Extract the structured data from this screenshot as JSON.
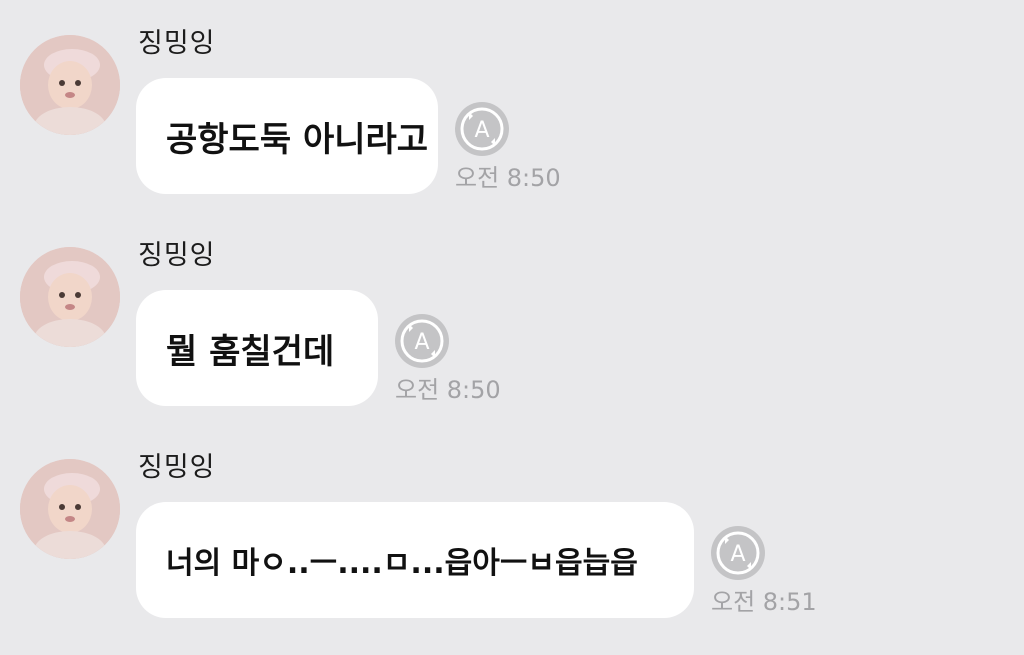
{
  "messages": [
    {
      "sender": "징밍잉",
      "text": "공항도둑 아니라고",
      "time": "오전 8:50",
      "avatar_icon": "baby-photo-avatar",
      "action_icon": "auto-translate-icon"
    },
    {
      "sender": "징밍잉",
      "text": "뭘 훔칠건데",
      "time": "오전 8:50",
      "avatar_icon": "baby-photo-avatar",
      "action_icon": "auto-translate-icon"
    },
    {
      "sender": "징밍잉",
      "text": "너의 마ㅇ..ㅡ....ㅁ...읍아ㅡㅂ읍늡읍",
      "time": "오전 8:51",
      "avatar_icon": "baby-photo-avatar",
      "action_icon": "auto-translate-icon"
    }
  ],
  "colors": {
    "background": "#e9e9eb",
    "bubble": "#ffffff",
    "icon_gray": "#c4c4c6",
    "time_text": "#a3a3a6"
  }
}
